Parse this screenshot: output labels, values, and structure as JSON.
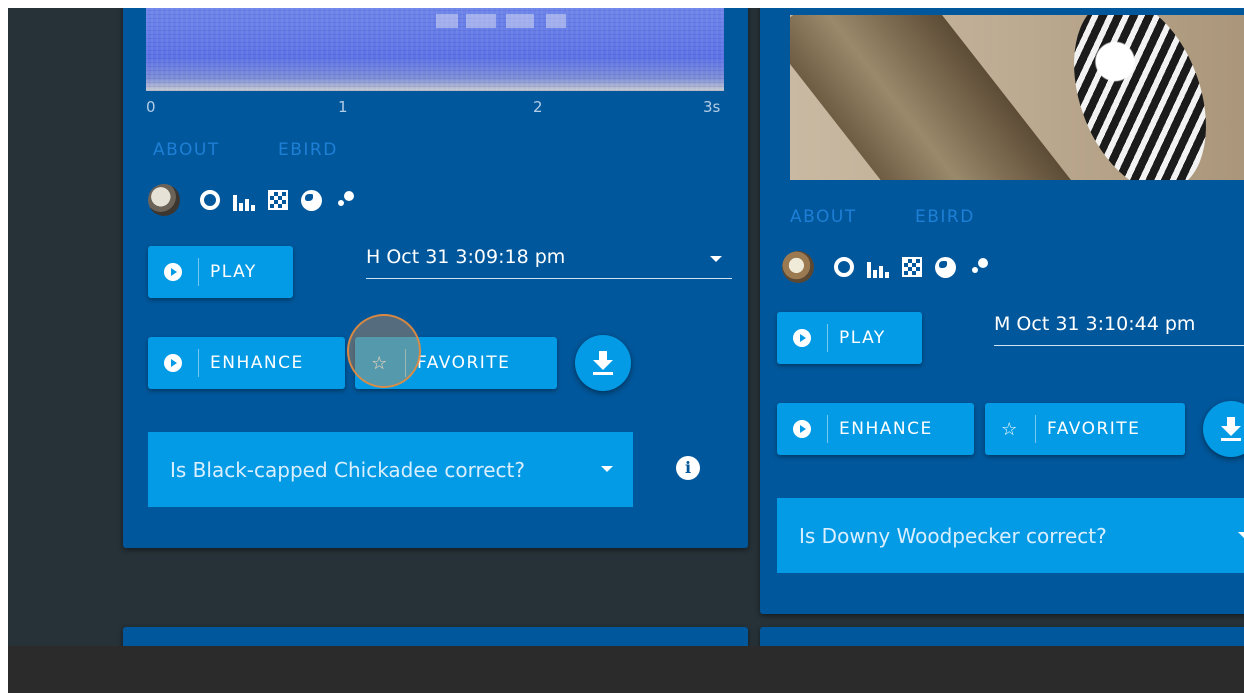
{
  "cards": [
    {
      "spectrogram_axis": [
        "0",
        "1",
        "2",
        "3s"
      ],
      "links": {
        "about": "ABOUT",
        "ebird": "EBIRD"
      },
      "buttons": {
        "play": "PLAY",
        "enhance": "ENHANCE",
        "favorite": "FAVORITE"
      },
      "recording_time": "H Oct 31 3:09:18 pm",
      "question": "Is Black-capped Chickadee correct?"
    },
    {
      "links": {
        "about": "ABOUT",
        "ebird": "EBIRD"
      },
      "buttons": {
        "play": "PLAY",
        "enhance": "ENHANCE",
        "favorite": "FAVORITE"
      },
      "recording_time": "M Oct 31 3:10:44 pm",
      "question": "Is Downy Woodpecker correct?"
    }
  ],
  "colors": {
    "background": "#263238",
    "card": "#01579b",
    "button": "#039be5",
    "link": "#1e7fd6",
    "highlight": "#e68c3c"
  },
  "icons": [
    "bird-avatar-icon",
    "ring-chart-icon",
    "bar-chart-icon",
    "checker-grid-icon",
    "globe-icon",
    "scatter-dots-icon",
    "play-icon",
    "star-icon",
    "download-icon",
    "caret-down-icon",
    "info-icon"
  ]
}
